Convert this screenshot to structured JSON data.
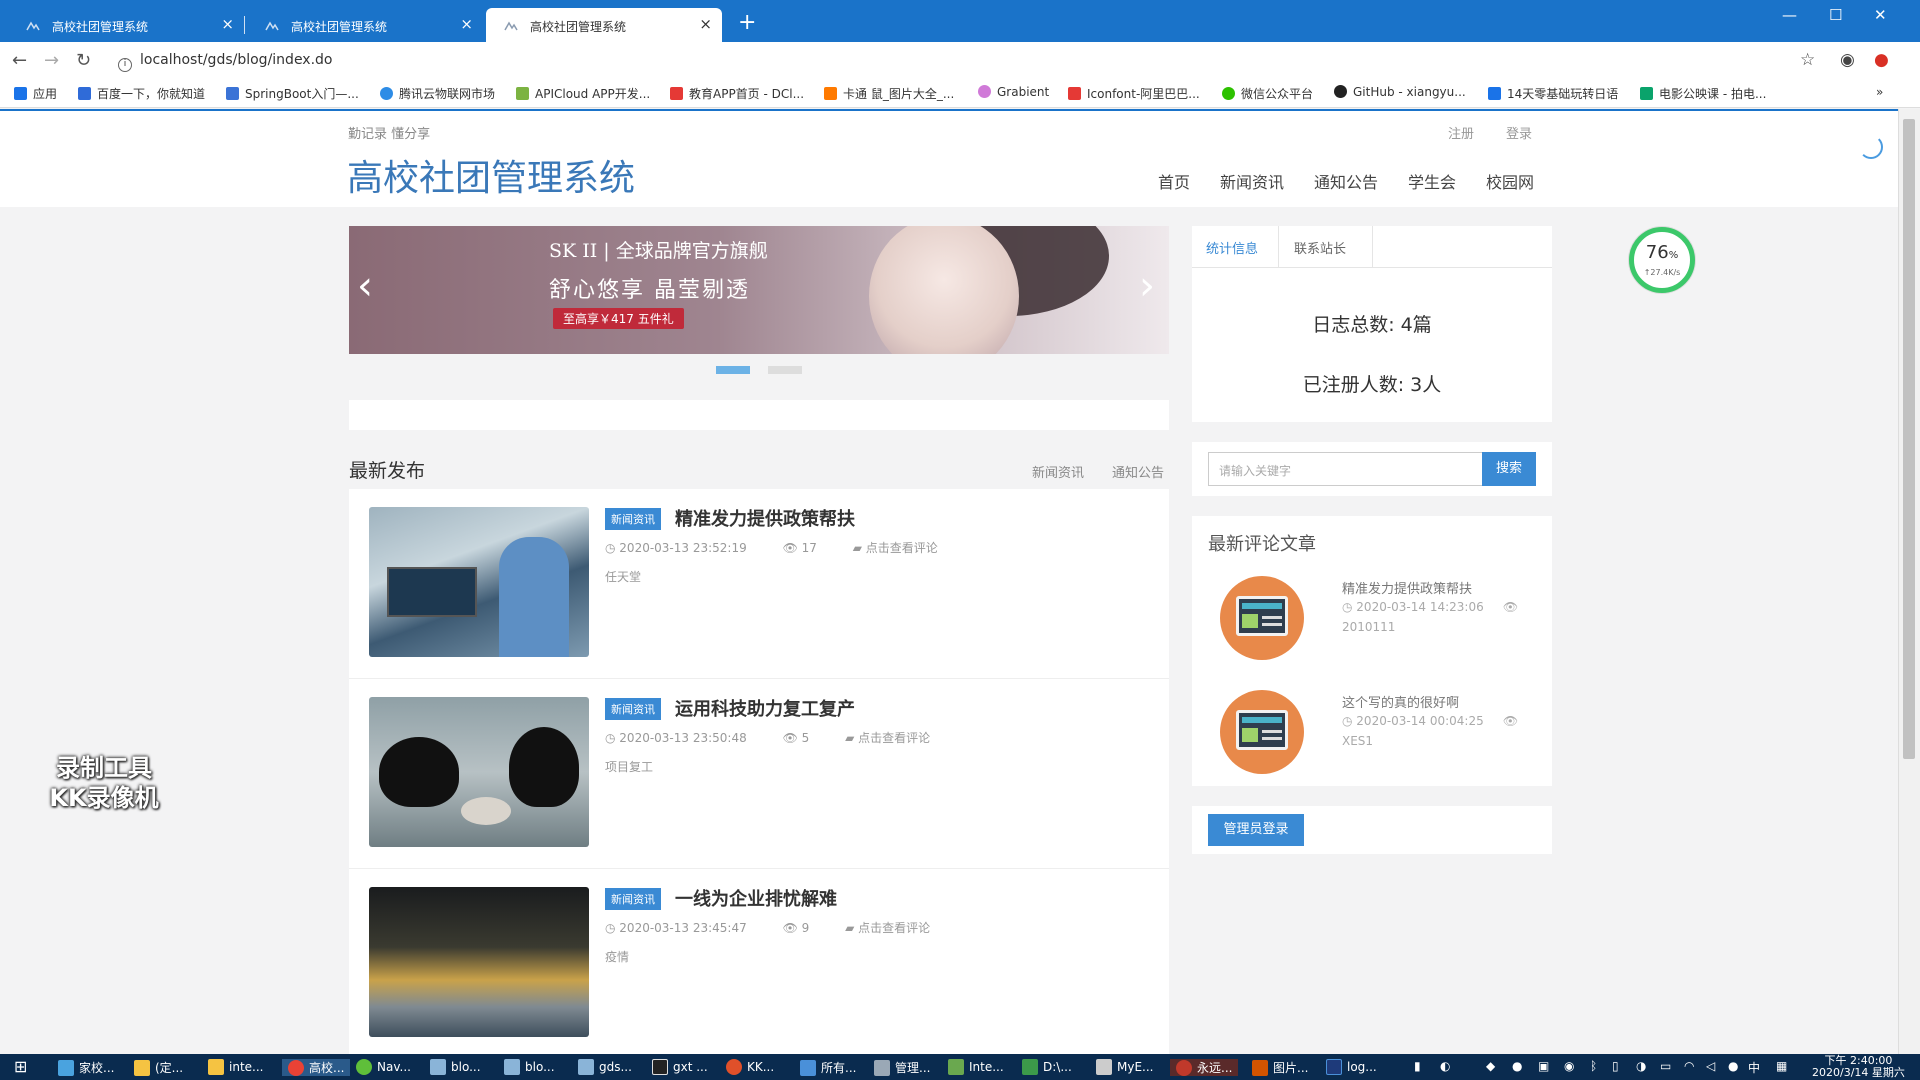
{
  "browser": {
    "tabs": [
      {
        "title": "高校社团管理系统",
        "active": false
      },
      {
        "title": "高校社团管理系统",
        "active": false
      },
      {
        "title": "高校社团管理系统",
        "active": true
      }
    ],
    "url": "localhost/gds/blog/index.do",
    "bookmarks": [
      "应用",
      "百度一下，你就知道",
      "SpringBoot入门—...",
      "腾讯云物联网市场",
      "APICloud APP开发...",
      "教育APP首页 - DCl...",
      "卡通 鼠_图片大全_...",
      "Grabient",
      "Iconfont-阿里巴巴...",
      "微信公众平台",
      "GitHub - xiangyu...",
      "14天零基础玩转日语",
      "电影公映课 - 拍电..."
    ]
  },
  "site": {
    "slogan": "勤记录 懂分享",
    "title": "高校社团管理系统",
    "toplinks": {
      "register": "注册",
      "login": "登录"
    },
    "nav": [
      "首页",
      "新闻资讯",
      "通知公告",
      "学生会",
      "校园网"
    ]
  },
  "banner": {
    "brand": "SK II | 全球品牌官方旗舰",
    "text": "舒心悠享 晶莹剔透",
    "tag": "至高享￥417 五件礼",
    "prev": "‹",
    "next": "›"
  },
  "latest": {
    "title": "最新发布",
    "links": [
      "新闻资讯",
      "通知公告"
    ],
    "posts": [
      {
        "category": "新闻资讯",
        "title": "精准发力提供政策帮扶",
        "date": "2020-03-13 23:52:19",
        "views": "17",
        "comments": "点击查看评论",
        "desc": "任天堂"
      },
      {
        "category": "新闻资讯",
        "title": "运用科技助力复工复产",
        "date": "2020-03-13 23:50:48",
        "views": "5",
        "comments": "点击查看评论",
        "desc": "项目复工"
      },
      {
        "category": "新闻资讯",
        "title": "一线为企业排忧解难",
        "date": "2020-03-13 23:45:47",
        "views": "9",
        "comments": "点击查看评论",
        "desc": "疫情"
      }
    ]
  },
  "sidebar": {
    "tabs": [
      "统计信息",
      "联系站长"
    ],
    "stats": {
      "logs": "日志总数: 4篇",
      "users": "已注册人数: 3人"
    },
    "search": {
      "placeholder": "请输入关键字",
      "button": "搜索"
    },
    "comments_title": "最新评论文章",
    "comments": [
      {
        "title": "精准发力提供政策帮扶",
        "date": "2020-03-14 14:23:06",
        "user": "2010111"
      },
      {
        "title": "这个写的真的很好啊",
        "date": "2020-03-14 00:04:25",
        "user": "XES1"
      }
    ],
    "admin_button": "管理员登录"
  },
  "gauge": {
    "value": "76",
    "unit": "%",
    "speed": "↑27.4K/s",
    "percent": 76
  },
  "watermark": {
    "line1": "录制工具",
    "line2": "KK录像机"
  },
  "taskbar": {
    "items": [
      "家校...",
      "(定...",
      "inte...",
      "高校...",
      "Nav...",
      "blo...",
      "blo...",
      "gds...",
      "gxt ...",
      "KK...",
      "所有...",
      "管理...",
      "Inte...",
      "D:\\...",
      "MyE...",
      "永远...",
      "图片...",
      "log..."
    ],
    "time": "下午 2:40:00",
    "date": "2020/3/14 星期六",
    "ime": "中"
  },
  "colors": {
    "accent": "#3a8ad4",
    "tabbar": "#1a73c9",
    "taskbar": "#0a2b4f",
    "gauge": "#3cc86a"
  }
}
